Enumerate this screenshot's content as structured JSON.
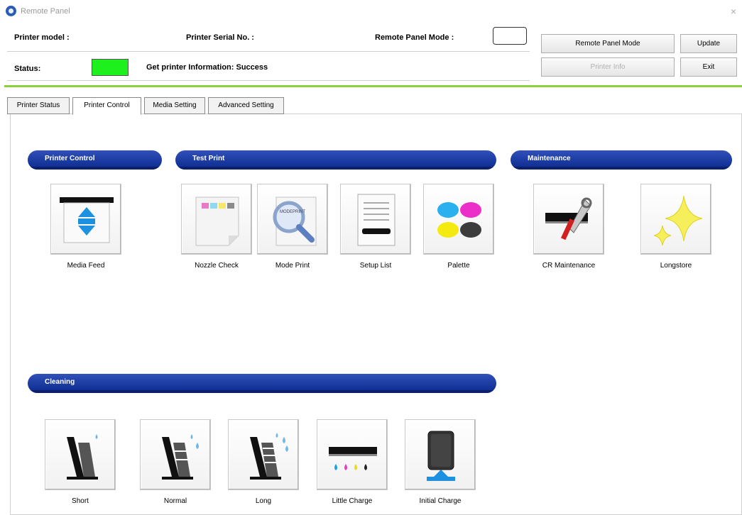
{
  "window": {
    "title": "Remote Panel",
    "close": "×"
  },
  "header": {
    "printer_model_label": "Printer model :",
    "printer_serial_label": "Printer Serial No. :",
    "remote_panel_mode_label": "Remote Panel Mode :",
    "status_label": "Status:",
    "status_message": "Get printer Information: Success",
    "status_color": "#1ef01e"
  },
  "buttons": {
    "remote_panel_mode": "Remote Panel Mode",
    "update": "Update",
    "printer_info": "Printer Info",
    "exit": "Exit"
  },
  "tabs": [
    {
      "label": "Printer Status"
    },
    {
      "label": "Printer Control",
      "active": true
    },
    {
      "label": "Media Setting"
    },
    {
      "label": "Advanced Setting"
    }
  ],
  "sections": {
    "printer_control": "Printer Control",
    "test_print": "Test Print",
    "maintenance": "Maintenance",
    "cleaning": "Cleaning"
  },
  "tiles": {
    "media_feed": "Media Feed",
    "nozzle_check": "Nozzle Check",
    "mode_print": "Mode Print",
    "setup_list": "Setup List",
    "palette": "Palette",
    "cr_maintenance": "CR Maintenance",
    "longstore": "Longstore",
    "short": "Short",
    "normal": "Normal",
    "long": "Long",
    "little_charge": "Little Charge",
    "initial_charge": "Initial Charge"
  },
  "mode_print_icon_text": "MODEPRINT",
  "colors": {
    "section": "#0a2a8f",
    "accent_line": "#8cd13a",
    "icon_blue": "#1e90e0"
  }
}
